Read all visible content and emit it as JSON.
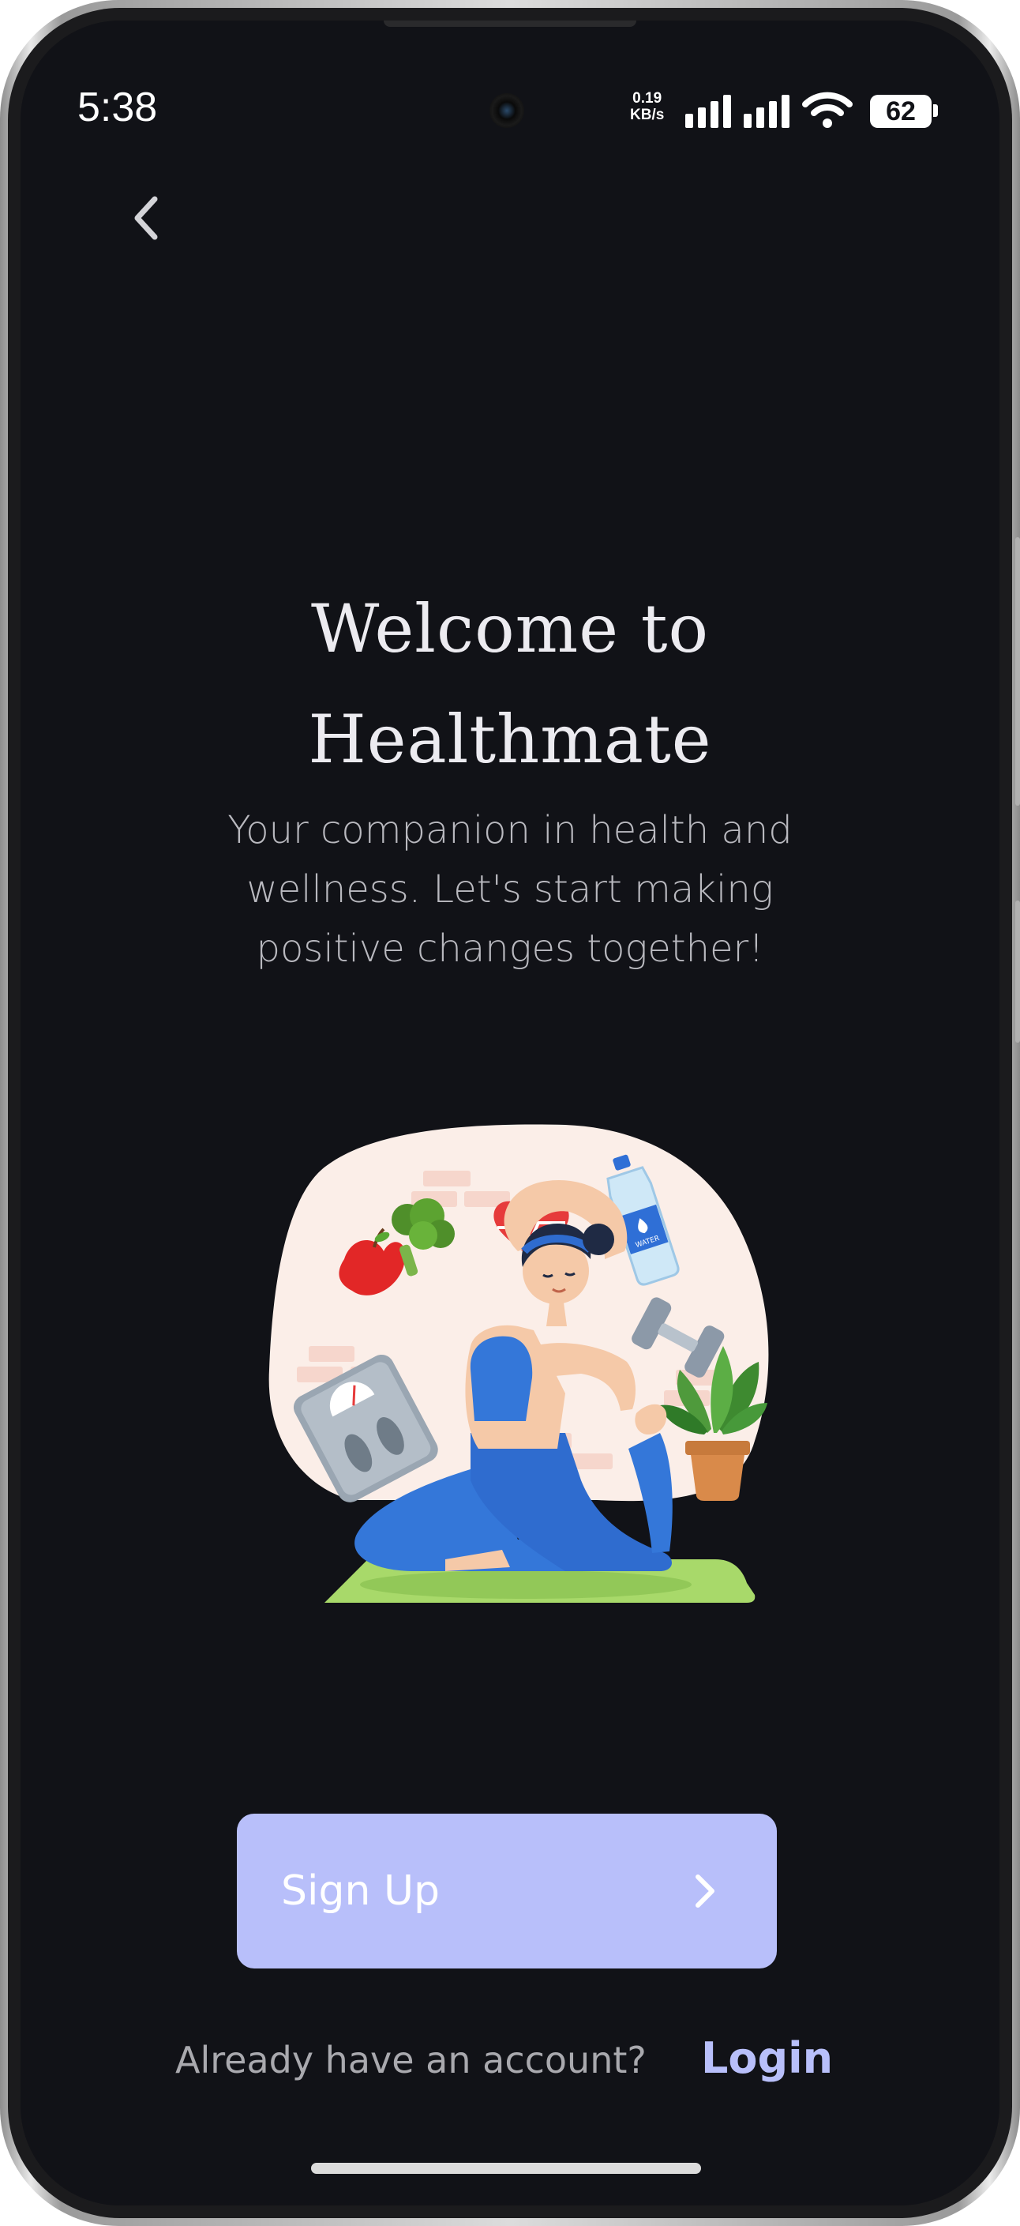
{
  "status_bar": {
    "time": "5:38",
    "net_speed_value": "0.19",
    "net_speed_unit": "KB/s",
    "battery": "62",
    "icons": [
      "signal-icon",
      "signal-icon",
      "wifi-icon",
      "battery-icon"
    ]
  },
  "nav": {
    "back_icon": "chevron-left-icon"
  },
  "welcome": {
    "title_line1": "Welcome to",
    "title_line2": "Healthmate",
    "subtitle": "Your companion in health and wellness. Let's start making positive changes together!"
  },
  "illustration": {
    "icons": [
      "heart-rate-icon",
      "water-bottle-icon",
      "dumbbell-icon",
      "apple-broccoli-icon",
      "weight-scale-icon",
      "plant-icon",
      "yoga-woman"
    ],
    "bottle_label": "WATER"
  },
  "actions": {
    "signup_label": "Sign Up",
    "signup_icon": "chevron-right-icon",
    "already_text": "Already have an account?",
    "login_label": "Login"
  },
  "colors": {
    "background": "#111217",
    "accent": "#b8bffa",
    "title": "#ecebf0"
  }
}
